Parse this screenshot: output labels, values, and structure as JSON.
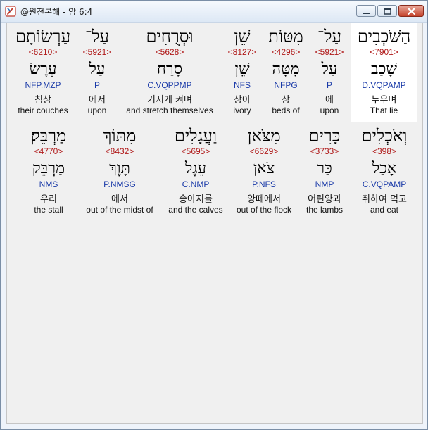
{
  "window": {
    "title": "@원전본해 - 암 6:4"
  },
  "row1": [
    {
      "heb": "הַשֹּׁכְבִים",
      "strong": "<7901>",
      "lemma": "שָׁכַב",
      "morph": "D.VQPAMP",
      "kor": "누우며",
      "eng": "That lie",
      "highlight": true
    },
    {
      "heb": "עַל־",
      "strong": "<5921>",
      "lemma": "עַל",
      "morph": "P",
      "kor": "에",
      "eng": "upon"
    },
    {
      "heb": "מִטּוֹת",
      "strong": "<4296>",
      "lemma": "מִטָּה",
      "morph": "NFPG",
      "kor": "상",
      "eng": "beds of"
    },
    {
      "heb": "שֵׁן",
      "strong": "<8127>",
      "lemma": "שֵׁן",
      "morph": "NFS",
      "kor": "상아",
      "eng": "ivory"
    },
    {
      "heb": "וּסְרֻחִים",
      "strong": "<5628>",
      "lemma": "סָרַח",
      "morph": "C.VQPPMP",
      "kor": "기지게 켜며",
      "eng": "and stretch themselves"
    },
    {
      "heb": "עַל־",
      "strong": "<5921>",
      "lemma": "עַל",
      "morph": "P",
      "kor": "에서",
      "eng": "upon"
    },
    {
      "heb": "עַרְשׂוֹתָם",
      "strong": "<6210>",
      "lemma": "עֶרֶשׂ",
      "morph": "NFP.MZP",
      "kor": "침상",
      "eng": "their couches"
    }
  ],
  "row2": [
    {
      "heb": "וְאֹכְלִים",
      "strong": "<398>",
      "lemma": "אָכַל",
      "morph": "C.VQPAMP",
      "kor": "취하여 먹고",
      "eng": "and eat"
    },
    {
      "heb": "כָּרִים",
      "strong": "<3733>",
      "lemma": "כַּר",
      "morph": "NMP",
      "kor": "어린양과",
      "eng": "the lambs"
    },
    {
      "heb": "מִצֹּאן",
      "strong": "<6629>",
      "lemma": "צֹאן",
      "morph": "P.NFS",
      "kor": "양떼에서",
      "eng": "out of the flock"
    },
    {
      "heb": "וַעֲגָלִים",
      "strong": "<5695>",
      "lemma": "עֵגֶל",
      "morph": "C.NMP",
      "kor": "송아지를",
      "eng": "and the calves"
    },
    {
      "heb": "מִתּוֹךְ",
      "strong": "<8432>",
      "lemma": "תָּוֶךְ",
      "morph": "P.NMSG",
      "kor": "에서",
      "eng": "out of the midst of"
    },
    {
      "heb": "מַרְבֵּק׃",
      "strong": "<4770>",
      "lemma": "מַרְבֵּק",
      "morph": "NMS",
      "kor": "우리",
      "eng": "the stall"
    }
  ]
}
